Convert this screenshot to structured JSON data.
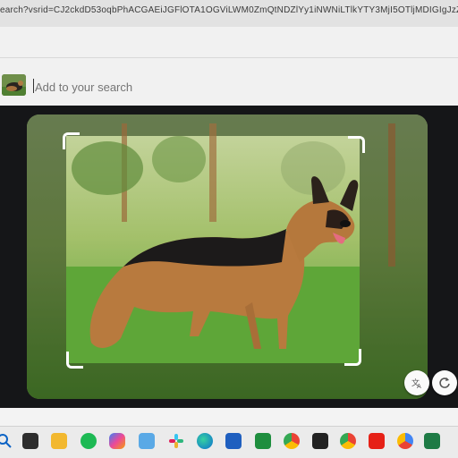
{
  "browser": {
    "url": "earch?vsrid=CJ2ckdD53oqbPhACGAEiJGFlOTA1OGViLWM0ZmQtNDZlYy1iNWNiLTlkYTY3MjI5OTljMDIGIgJzZ"
  },
  "search": {
    "placeholder": "Add to your search"
  },
  "image": {
    "subject_icon": "german-shepherd-dog-photo"
  },
  "controls": {
    "translate_icon": "translate-icon",
    "refresh_icon": "refresh-icon"
  },
  "taskbar": {
    "icons": [
      "search-icon",
      "terminal-icon",
      "file-explorer-icon",
      "spotify-icon",
      "copilot-icon",
      "photos-icon",
      "slack-icon",
      "edge-icon",
      "store-icon",
      "xbox-icon",
      "chrome-icon",
      "terminal-dark-icon",
      "chrome-beta-icon",
      "youtube-icon",
      "chrome-dev-icon",
      "excel-icon"
    ]
  },
  "colors": {
    "panel_bg": "#151618",
    "page_bg": "#f1f1f1",
    "taskbar_bg": "#ebebeb",
    "grass": "#5f9a3a"
  }
}
